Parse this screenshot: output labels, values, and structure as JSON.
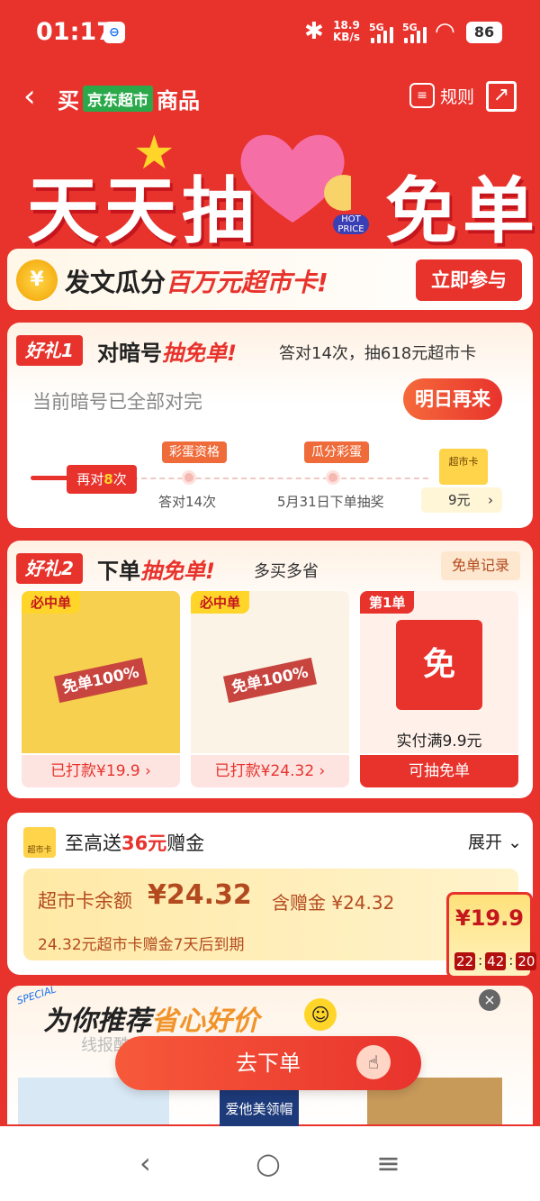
{
  "status_bar": {
    "time": "01:17",
    "speed_value": "18.9",
    "speed_unit": "KB/s",
    "sig1": "5G",
    "sig2": "5G",
    "battery": "86"
  },
  "nav": {
    "back_icon": "‹",
    "title_pre": "买",
    "jd_tag": "京东超市",
    "title_post": "商品",
    "rules_label": "规则"
  },
  "banner": {
    "title_left": "天天抽",
    "title_right": "免单",
    "hot": "HOT PRICE"
  },
  "promo": {
    "coin": "¥",
    "text_pre": "发文瓜分",
    "text_highlight": "百万元超市卡!",
    "join_label": "立即参与"
  },
  "gift1": {
    "tag": "好礼1",
    "title_pre": "对暗号",
    "title_highlight": "抽免单!",
    "subtitle": "答对14次，抽618元超市卡",
    "status": "当前暗号已全部对完",
    "tomorrow_label": "明日再来",
    "again_pre": "再对",
    "again_num": "8",
    "again_post": "次",
    "milestones": [
      {
        "pill": "彩蛋资格",
        "label": "答对14次"
      },
      {
        "pill": "瓜分彩蛋",
        "label": "5月31日下单抽奖"
      }
    ],
    "card_label": "超市卡",
    "card_value": "9元"
  },
  "gift2": {
    "tag": "好礼2",
    "title_pre": "下单",
    "title_highlight": "抽免单!",
    "subtitle": "多买多省",
    "record_label": "免单记录",
    "products": [
      {
        "badge": "必中单",
        "stamp": "免单100%",
        "button": "已打款¥19.9 ›"
      },
      {
        "badge": "必中单",
        "stamp": "免单100%",
        "button": "已打款¥24.32 ›"
      }
    ],
    "third": {
      "badge": "第1单",
      "bag_text": "免",
      "note": "实付满9.9元",
      "button": "可抽免单"
    }
  },
  "bonus": {
    "icon_label": "超市卡",
    "title_pre": "至高送",
    "title_amount": "36元",
    "title_post": "赠金",
    "expand_label": "展开",
    "balance_label": "超市卡余额",
    "balance_value": "¥24.32",
    "gift_label": "含赠金 ¥24.32",
    "expiry": "24.32元超市卡赠金7天后到期"
  },
  "float_price": {
    "price": "¥19.9",
    "countdown": [
      "22",
      "42",
      "20"
    ]
  },
  "recommend": {
    "special": "SPECIAL",
    "title_pre": "为你推荐",
    "title_highlight": "省心好价",
    "watermark": "线报酷-new.xianbao.fun",
    "order_label": "去下单",
    "product2_text": "爱他美领帽"
  },
  "colors": {
    "primary": "#e8332d",
    "gold": "#ffd52a",
    "green_tag": "#2aa84a"
  }
}
